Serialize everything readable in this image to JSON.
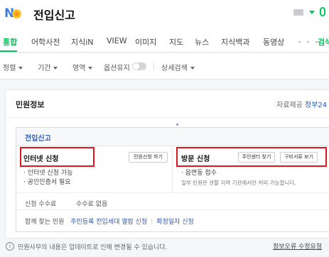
{
  "header": {
    "query": "전입신고",
    "brand_color": "#03c75a"
  },
  "tabs": [
    {
      "label": "통합",
      "active": true
    },
    {
      "label": "어학사전"
    },
    {
      "label": "지식iN"
    },
    {
      "label": "VIEW"
    },
    {
      "label": "이미지"
    },
    {
      "label": "지도"
    },
    {
      "label": "뉴스"
    },
    {
      "label": "지식백과"
    },
    {
      "label": "동영상"
    },
    {
      "label": "・・・"
    },
    {
      "label": "검색"
    }
  ],
  "filters": {
    "sort": "정렬",
    "period": "기간",
    "area": "영역",
    "keep_option": "옵션유지",
    "advanced": "상세검색"
  },
  "card": {
    "title": "민원정보",
    "source_label": "자료제공",
    "source_link": "정부24",
    "section_title": "전입신고",
    "internet": {
      "title": "인터넷 신청",
      "button": "민원신청 하기",
      "items": [
        "인터넷 신청 가능",
        "공인인증서 필요"
      ]
    },
    "visit": {
      "title": "방문 신청",
      "btn_find": "주민센터 찾기",
      "btn_docs": "구비서류 보기",
      "item": "읍면동 접수",
      "note": "일부 민원은 관할 지역 기관에서만 처리 가능합니다."
    },
    "fee_label": "신청 수수료",
    "fee_value": "수수료 없음",
    "related_label": "함께 찾는 민원",
    "related": [
      "주민등록 전입세대 열람 신청",
      "확정일자 신청"
    ]
  },
  "footer": {
    "notice": "민원사무의 내용은 업데이트로 인해 변경될 수 있습니다.",
    "report": "정보오류 수정요청"
  }
}
